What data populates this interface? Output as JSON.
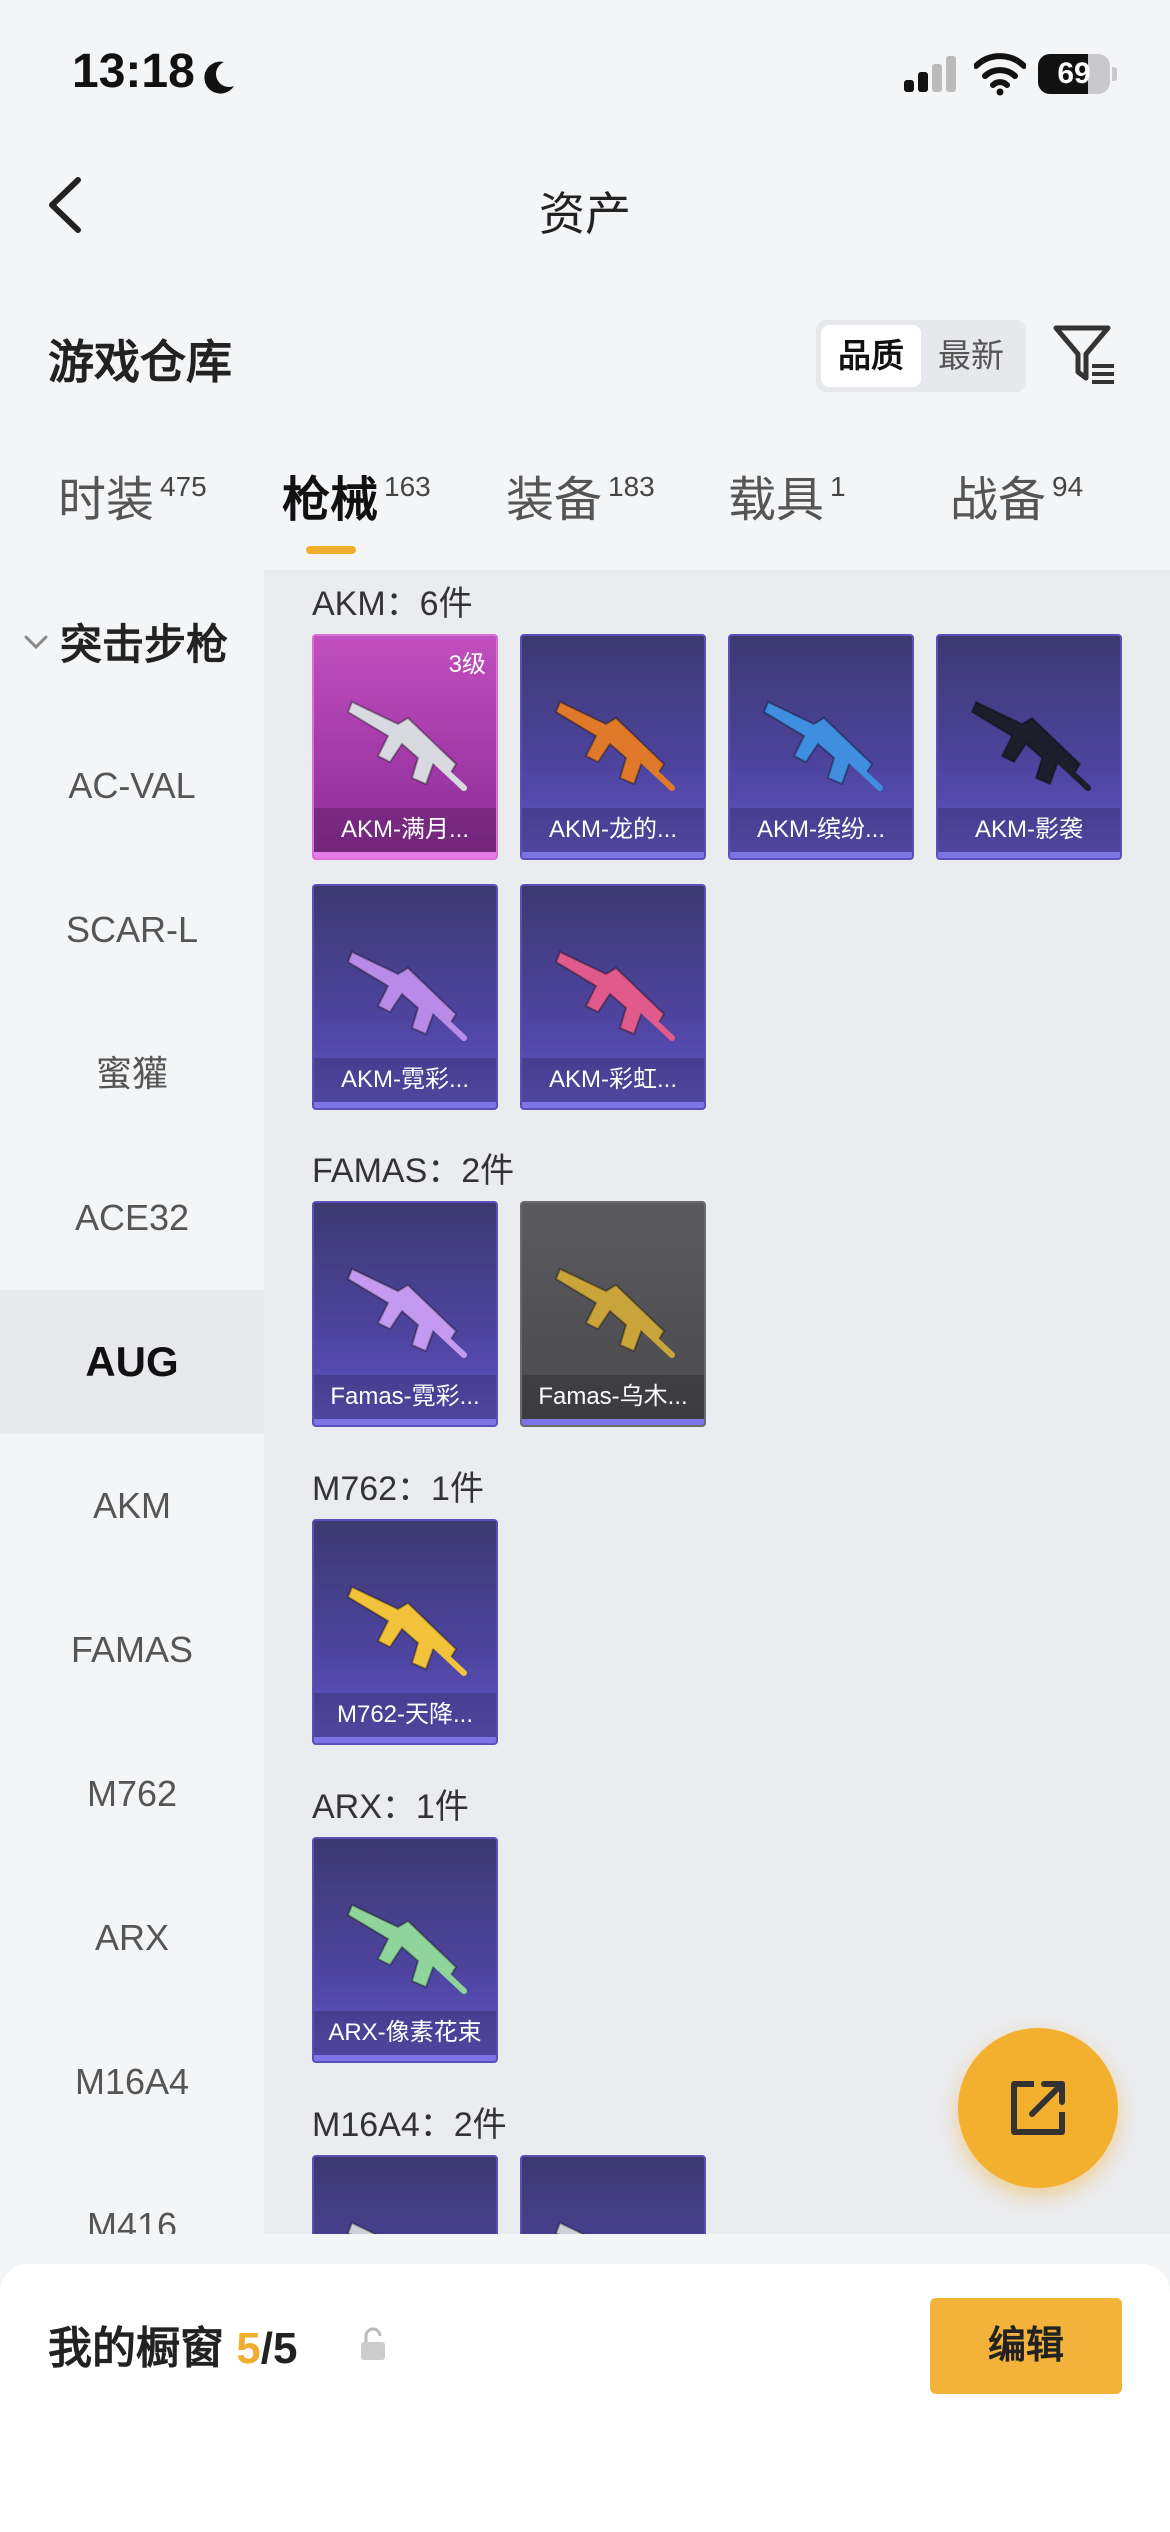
{
  "status_bar": {
    "time": "13:18",
    "battery": "69",
    "battery_level": 0.69
  },
  "nav": {
    "title": "资产"
  },
  "section": {
    "title": "游戏仓库"
  },
  "sort": {
    "options": [
      "品质",
      "最新"
    ],
    "active": "品质"
  },
  "tabs": [
    {
      "label": "时装",
      "count": "475"
    },
    {
      "label": "枪械",
      "count": "163",
      "active": true
    },
    {
      "label": "装备",
      "count": "183"
    },
    {
      "label": "载具",
      "count": "1"
    },
    {
      "label": "战备",
      "count": "94"
    }
  ],
  "sidebar": {
    "group": "突击步枪",
    "items": [
      "AC-VAL",
      "SCAR-L",
      "蜜獾",
      "ACE32",
      "AUG",
      "AKM",
      "FAMAS",
      "M762",
      "ARX",
      "M16A4",
      "M416"
    ],
    "active": "AUG"
  },
  "groups": [
    {
      "title": "AKM：6件",
      "items": [
        {
          "name": "AKM-满月...",
          "level": "3级",
          "rarity": "pink",
          "color": "#d9d9e2"
        },
        {
          "name": "AKM-龙的...",
          "rarity": "purple",
          "color": "#e07a2a"
        },
        {
          "name": "AKM-缤纷...",
          "rarity": "purple",
          "color": "#3f8ee0"
        },
        {
          "name": "AKM-影袭",
          "rarity": "purple",
          "color": "#1d1d2b"
        },
        {
          "name": "AKM-霓彩...",
          "rarity": "purple",
          "color": "#b98ae8"
        },
        {
          "name": "AKM-彩虹...",
          "rarity": "purple",
          "color": "#e05a8c"
        }
      ]
    },
    {
      "title": "FAMAS：2件",
      "items": [
        {
          "name": "Famas-霓彩...",
          "rarity": "purple",
          "color": "#c39af0"
        },
        {
          "name": "Famas-乌木...",
          "rarity": "gray",
          "color": "#c9a43a"
        }
      ]
    },
    {
      "title": "M762：1件",
      "items": [
        {
          "name": "M762-天降...",
          "rarity": "purple",
          "color": "#f2c23a"
        }
      ]
    },
    {
      "title": "ARX：1件",
      "items": [
        {
          "name": "ARX-像素花束",
          "rarity": "purple",
          "color": "#8fd49a"
        }
      ]
    },
    {
      "title": "M16A4：2件",
      "items": [
        {
          "name": "",
          "rarity": "purple",
          "color": "#cfcfd8"
        },
        {
          "name": "",
          "rarity": "purple",
          "color": "#cfcfd8"
        }
      ]
    }
  ],
  "showcase": {
    "label": "我的橱窗",
    "count": "5",
    "total": "/5",
    "edit_label": "编辑"
  }
}
